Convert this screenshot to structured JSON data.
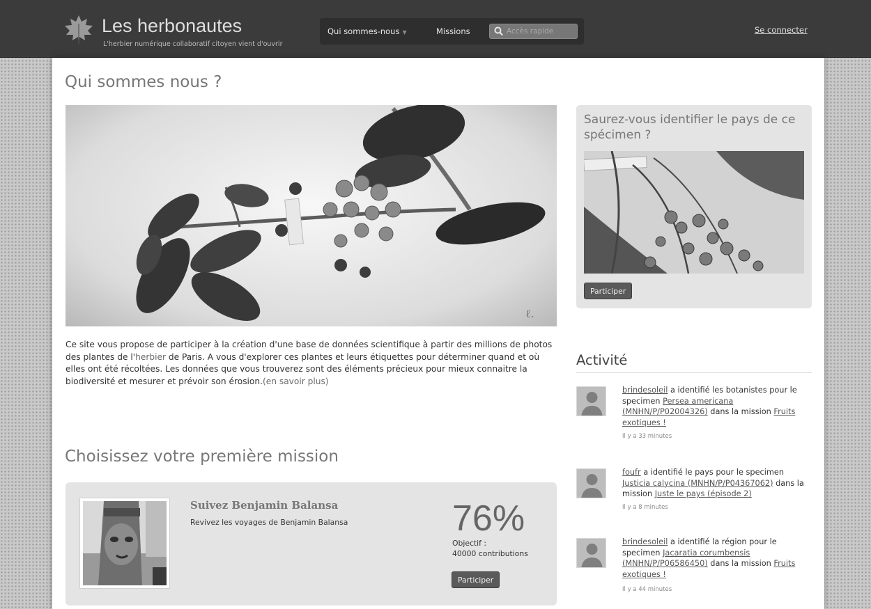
{
  "header": {
    "brand_title": "Les herbonautes",
    "brand_subtitle": "L'herbier numérique collaboratif citoyen vient d'ouvrir",
    "nav": [
      {
        "label": "Qui sommes-nous"
      },
      {
        "label": "Missions"
      }
    ],
    "search_placeholder": "Accès rapide",
    "login_label": "Se connecter",
    "icons": [
      "leaf-logo-icon",
      "caret-down-icon",
      "search-icon"
    ]
  },
  "main": {
    "page_title": "Qui sommes nous ?",
    "hero_signature": "ℓ.",
    "intro": {
      "part1": "Ce site vous propose de participer à la création d'une base de données scientifique à partir des millions de photos des plantes de l'",
      "link_herbier": "herbier",
      "part2": " de Paris. A vous d'explorer ces plantes et leurs étiquettes pour déterminer quand et où elles ont été récoltées. Les données que vous trouverez sont des éléments précieux pour mieux connaitre la biodiversité et mesurer et prévoir son érosion.",
      "link_more": "(en savoir plus)"
    },
    "missions_title": "Choisissez votre première mission",
    "mission": {
      "title": "Suivez Benjamin Balansa",
      "description": "Revivez les voyages de Benjamin Balansa",
      "percent": "76%",
      "goal_line1": "Objectif :",
      "goal_line2": "40000 contributions",
      "button_label": "Participer"
    }
  },
  "sidebar": {
    "identify": {
      "title": "Saurez-vous identifier le pays de ce spécimen ?",
      "button_label": "Participer"
    },
    "activity": {
      "title": "Activité",
      "items": [
        {
          "user": "brindesoleil",
          "action": " a identifié les botanistes pour le specimen ",
          "specimen": "Persea americana (MNHN/P/P02004326)",
          "connector": " dans la mission ",
          "mission": "Fruits exotiques !",
          "time": "Il y a 33 minutes"
        },
        {
          "user": "foufr",
          "action": " a identifié le pays pour le specimen ",
          "specimen": "Justicia calycina (MNHN/P/P04367062)",
          "connector": " dans la mission ",
          "mission": "Juste le pays (épisode 2)",
          "time": "Il y a 8 minutes"
        },
        {
          "user": "brindesoleil",
          "action": " a identifié la région pour le specimen ",
          "specimen": "Jacaratia corumbensis (MNHN/P/P06586450)",
          "connector": " dans la mission ",
          "mission": "Fruits exotiques !",
          "time": "Il y a 44 minutes"
        }
      ]
    }
  },
  "colors": {
    "topbar": "#3b3b3b",
    "button": "#5a5a5a",
    "card_bg": "#e4e4e4",
    "heading_gray": "#777777"
  }
}
